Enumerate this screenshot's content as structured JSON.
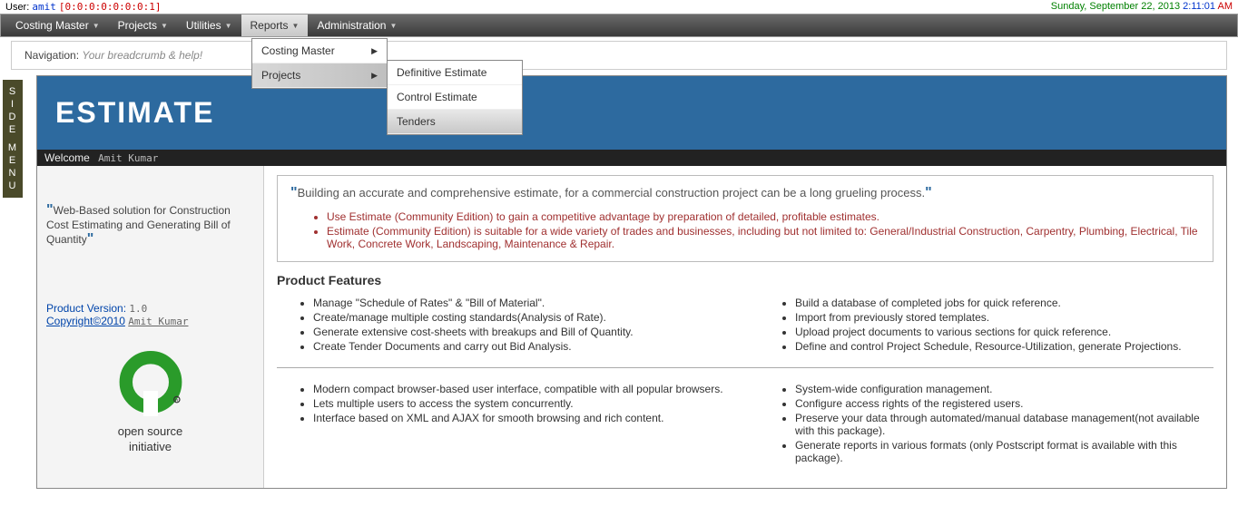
{
  "topbar": {
    "user_label": "User:",
    "username": "amit",
    "ip": "[0:0:0:0:0:0:0:1]",
    "date": "Sunday, September 22, 2013",
    "time_hm": "2:11:01",
    "time_ampm": "AM"
  },
  "menu": {
    "items": [
      "Costing Master",
      "Projects",
      "Utilities",
      "Reports",
      "Administration"
    ],
    "active_index": 3,
    "dropdown": {
      "items": [
        "Costing Master",
        "Projects"
      ],
      "highlighted_index": 1,
      "sub_items": [
        "Definitive Estimate",
        "Control Estimate",
        "Tenders"
      ],
      "sub_hovered_index": 2
    }
  },
  "sidemenu_label": "SIDE MENU",
  "nav": {
    "label": "Navigation:",
    "help": "Your breadcrumb & help!"
  },
  "header": {
    "title": "ESTIMATE",
    "welcome": "Welcome",
    "welcome_name": "Amit Kumar"
  },
  "sidebar": {
    "blurb": "Web-Based solution for Construction Cost Estimating and Generating Bill of Quantity",
    "version_label": "Product Version:",
    "version_value": "1.0",
    "copyright": "Copyright©2010",
    "copyright_name": "Amit Kumar",
    "osi_caption1": "open source",
    "osi_caption2": "initiative"
  },
  "main": {
    "tagline": "Building an accurate and comprehensive estimate, for a commercial construction project can be a long grueling process.",
    "highlights": [
      "Use Estimate (Community Edition) to gain a competitive advantage by preparation of detailed, profitable estimates.",
      "Estimate (Community Edition) is suitable for a wide variety of trades and businesses, including but not limited to: General/Industrial Construction, Carpentry, Plumbing, Electrical, Tile Work, Concrete Work, Landscaping, Maintenance & Repair."
    ],
    "features_title": "Product Features",
    "features_left": [
      "Manage \"Schedule of Rates\" & \"Bill of Material\".",
      "Create/manage multiple costing standards(Analysis of Rate).",
      "Generate extensive cost-sheets with breakups and Bill of Quantity.",
      "Create Tender Documents and carry out Bid Analysis."
    ],
    "features_right": [
      "Build a database of completed jobs for quick reference.",
      "Import from previously stored templates.",
      "Upload project documents to various sections for quick reference.",
      "Define and control Project Schedule, Resource-Utilization, generate Projections."
    ],
    "tech_left": [
      "Modern compact browser-based user interface, compatible with all popular browsers.",
      "Lets multiple users to access the system concurrently.",
      "Interface based on XML and AJAX for smooth browsing and rich content."
    ],
    "tech_right": [
      "System-wide configuration management.",
      "Configure access rights of the registered users.",
      "Preserve your data through automated/manual database management(not available with this package).",
      "Generate reports in various formats (only Postscript format is available with this package)."
    ]
  }
}
